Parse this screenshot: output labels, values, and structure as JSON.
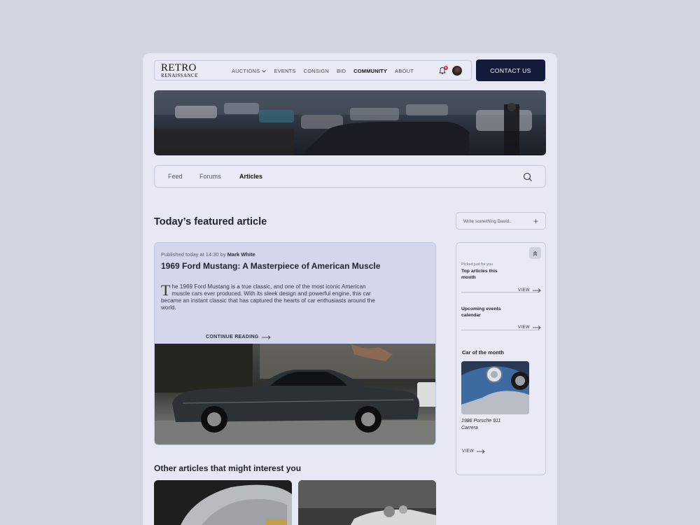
{
  "brand": {
    "line1": "RETRO",
    "line2": "RENAISSANCE"
  },
  "nav": {
    "items": [
      {
        "label": "AUCTIONS",
        "dropdown": true,
        "active": false
      },
      {
        "label": "EVENTS",
        "active": false
      },
      {
        "label": "CONSIGN",
        "active": false
      },
      {
        "label": "BID",
        "active": false
      },
      {
        "label": "COMMUNITY",
        "active": true
      },
      {
        "label": "ABOUT",
        "active": false
      }
    ],
    "notification_count": "5",
    "contact_label": "CONTACT US"
  },
  "tabs": {
    "feed": "Feed",
    "forums": "Forums",
    "articles": "Articles",
    "active": "Articles"
  },
  "featured": {
    "heading": "Today’s featured article",
    "published_prefix": "Published today at 14:30 by ",
    "author": "Mark White",
    "title": "1969 Ford Mustang: A Masterpiece of American Muscle",
    "dropcap": "T",
    "excerpt": "he 1969 Ford Mustang is a true classic, and one of the most iconic American muscle cars ever produced. With its sleek design and powerful engine, this car became an instant classic that has captured the hearts of car enthusiasts around the world.",
    "continue_label": "CONTINUE READING"
  },
  "other": {
    "heading": "Other articles that might interest you"
  },
  "composer": {
    "placeholder": "Write something David..",
    "plus": "+"
  },
  "sidebar": {
    "picked_label": "Picked just for you",
    "top_articles": "Top articles this month",
    "upcoming": "Upcoming events calendar",
    "view_label": "VIEW",
    "car_of_month_title": "Car of the month",
    "car_name": "1986 Porsche 911 Carrera"
  },
  "colors": {
    "accent": "#151b3a",
    "badge": "#d4343f",
    "background": "#d2d6e0",
    "card": "#e6e9f4"
  }
}
